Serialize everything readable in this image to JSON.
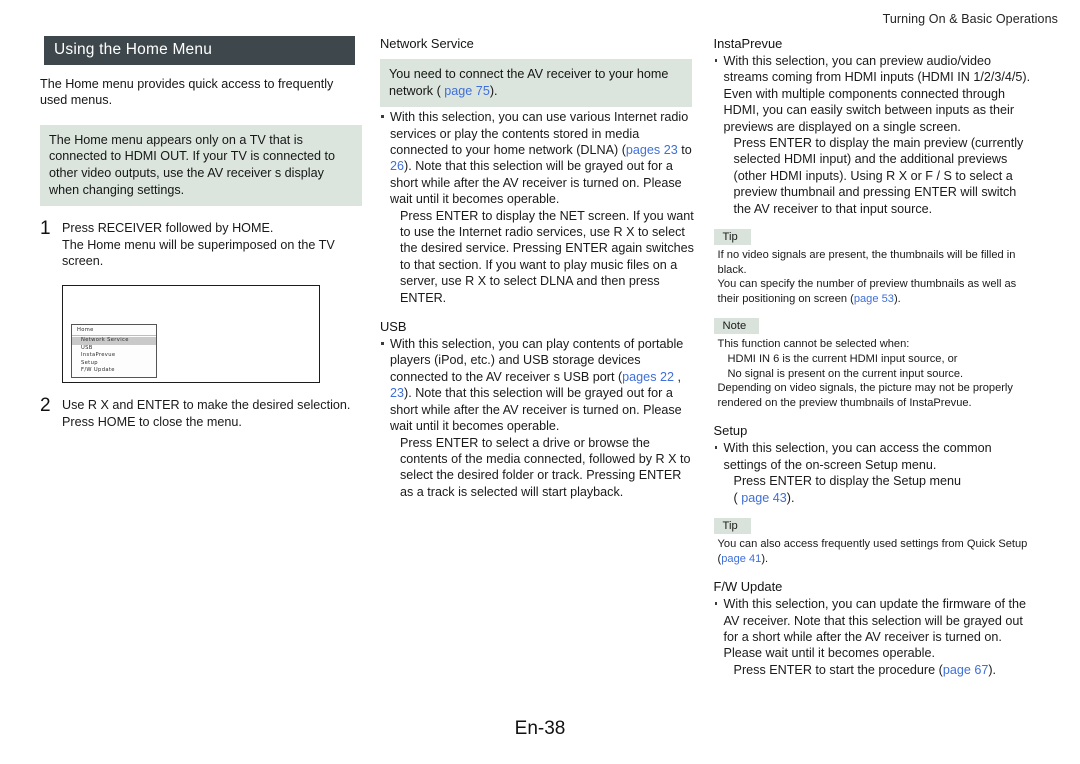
{
  "header": {
    "running_title": "Turning On & Basic Operations"
  },
  "footer": {
    "folio": "En-38"
  },
  "left": {
    "section_title": "Using the Home Menu",
    "intro": "The Home menu provides quick access to frequently used menus.",
    "caution_box": "The Home menu appears only on a TV that is connected to HDMI OUT. If your TV is connected to other video outputs, use the AV receiver s display when changing settings.",
    "steps": [
      {
        "num": "1",
        "lead": "Press RECEIVER followed by HOME.",
        "sub": "The Home menu will be superimposed on the TV screen."
      },
      {
        "num": "2",
        "lead": "Use R X and ENTER to make the desired selection.",
        "sub": "Press HOME to close the menu."
      }
    ],
    "osd": {
      "title": "Home",
      "items": [
        "Network Service",
        "USB",
        "InstaPrevue",
        "Setup",
        "F/W Update"
      ],
      "selected_index": 0
    }
  },
  "middle": {
    "network_service": {
      "heading": "Network Service",
      "note_box_pre": "You need to connect the AV receiver to your home network (",
      "note_box_link": "page 75",
      "note_box_post": ").",
      "bullet_1_a": "With this selection, you can use various Internet radio services or play the contents stored in media connected to your home network (DLNA) (",
      "bullet_1_link_a": "pages 23",
      "bullet_1_mid": " to ",
      "bullet_1_link_b": "26",
      "bullet_1_b": "). Note that this selection will be grayed out for a short while after the AV receiver is turned on. Please wait until it becomes operable.",
      "indent_1": "Press ENTER to display the NET screen. If you want to use the Internet radio services, use R X to select the desired service. Pressing ENTER again switches to that section. If you want to play music files on a server, use R X to select DLNA and then press ENTER."
    },
    "usb": {
      "heading": "USB",
      "bullet_1_a": "With this selection, you can play contents of portable players (iPod, etc.) and USB storage devices connected to the AV receiver s USB port (",
      "bullet_1_link_a": "pages 22",
      "bullet_1_sep": " , ",
      "bullet_1_link_b": "23",
      "bullet_1_b": "). Note that this selection will be grayed out for a short while after the AV receiver is turned on. Please wait until it becomes operable.",
      "indent_1": "Press ENTER to select a drive or browse the contents of the media connected, followed by R X to select the desired folder or track. Pressing ENTER as a track is selected will start playback."
    }
  },
  "right": {
    "instaprevue": {
      "heading": "InstaPrevue",
      "bullet_1": "With this selection, you can preview audio/video streams coming from HDMI inputs (HDMI IN 1/2/3/4/5). Even with multiple components connected through HDMI, you can easily switch between inputs as their previews are displayed on a single screen.",
      "indent_1": "Press ENTER to display the main preview (currently selected HDMI input) and the additional previews (other HDMI inputs). Using R X or F / S to select a preview thumbnail and pressing ENTER will switch the AV receiver to that input source.",
      "tip_label": "Tip",
      "tip_line_1": "If no video signals are present, the thumbnails will be filled in black.",
      "tip_line_2_pre": "You can specify the number of preview thumbnails as well as their positioning on screen (",
      "tip_line_2_link": "page 53",
      "tip_line_2_post": ").",
      "note_label": "Note",
      "note_line_1": "This function cannot be selected when:",
      "note_line_2": "HDMI IN 6 is the current HDMI input source, or",
      "note_line_3": "No signal is present on the current input source.",
      "note_line_4": "Depending on video signals, the picture may not be properly rendered on the preview thumbnails of InstaPrevue."
    },
    "setup": {
      "heading": "Setup",
      "bullet_1": "With this selection, you can access the common settings of the on-screen Setup menu.",
      "indent_1": "Press ENTER to display the Setup menu",
      "indent_2_pre": "(",
      "indent_2_link": "page 43",
      "indent_2_post": ").",
      "tip_label": "Tip",
      "tip_line_1_pre": "You can also access frequently used settings from Quick Setup (",
      "tip_line_1_link": "page 41",
      "tip_line_1_post": ")."
    },
    "fw_update": {
      "heading": "F/W Update",
      "bullet_1": "With this selection, you can update the firmware of the AV receiver. Note that this selection will be grayed out for a short while after the AV receiver is turned on. Please wait until it becomes operable.",
      "indent_1_pre": "Press ENTER to start the procedure (",
      "indent_1_link": "page 67",
      "indent_1_post": ")."
    }
  }
}
